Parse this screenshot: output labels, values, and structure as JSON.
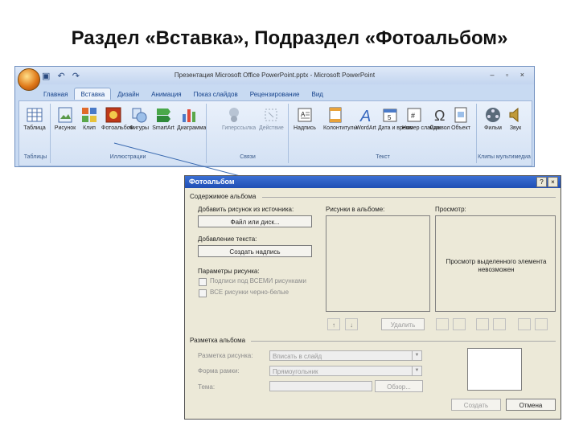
{
  "slide": {
    "title": "Раздел «Вставка», Подраздел «Фотоальбом»"
  },
  "ppt": {
    "window_title": "Презентация Microsoft Office PowerPoint.pptx - Microsoft PowerPoint",
    "qat": "▣ ↶ ↷",
    "win_controls": "– ▫ ×",
    "tabs": [
      "Главная",
      "Вставка",
      "Дизайн",
      "Анимация",
      "Показ слайдов",
      "Рецензирование",
      "Вид"
    ],
    "buttons": {
      "table": "Таблица",
      "picture": "Рисунок",
      "clip": "Клип",
      "photoalbum": "Фотоальбом",
      "shapes": "Фигуры",
      "smartart": "SmartArt",
      "chart": "Диаграмма",
      "hyperlink": "Гиперссылка",
      "action": "Действие",
      "textbox": "Надпись",
      "header_footer": "Колонтитулы",
      "wordart": "WordArt",
      "datetime": "Дата и время",
      "slide_number": "Номер слайда",
      "symbol": "Символ",
      "object": "Объект",
      "movie": "Фильм",
      "sound": "Звук"
    },
    "groups": {
      "tables": "Таблицы",
      "illustrations": "Иллюстрации",
      "links": "Связи",
      "text": "Текст",
      "media": "Клипы мультимедиа"
    }
  },
  "dialog": {
    "title": "Фотоальбом",
    "help": "?",
    "close": "×",
    "album_content": "Содержимое альбома",
    "insert_from": "Добавить рисунок из источника:",
    "file_disk_button": "Файл или диск...",
    "insert_text": "Добавление текста:",
    "new_textbox_button": "Создать надпись",
    "picture_options": "Параметры рисунка:",
    "captions_below": "Подписи под ВСЕМИ рисунками",
    "all_bw": "ВСЕ рисунки черно-белые",
    "pictures_in_album": "Рисунки в альбоме:",
    "preview": "Просмотр:",
    "preview_unavailable": "Просмотр выделенного элемента невозможен",
    "up_arrow": "↑",
    "down_arrow": "↓",
    "remove_button": "Удалить",
    "album_layout": "Разметка альбома",
    "picture_layout_label": "Разметка рисунка:",
    "picture_layout_value": "Вписать в слайд",
    "frame_shape_label": "Форма рамки:",
    "frame_shape_value": "Прямоугольник",
    "theme_label": "Тема:",
    "browse_button": "Обзор...",
    "create_button": "Создать",
    "cancel_button": "Отмена"
  }
}
